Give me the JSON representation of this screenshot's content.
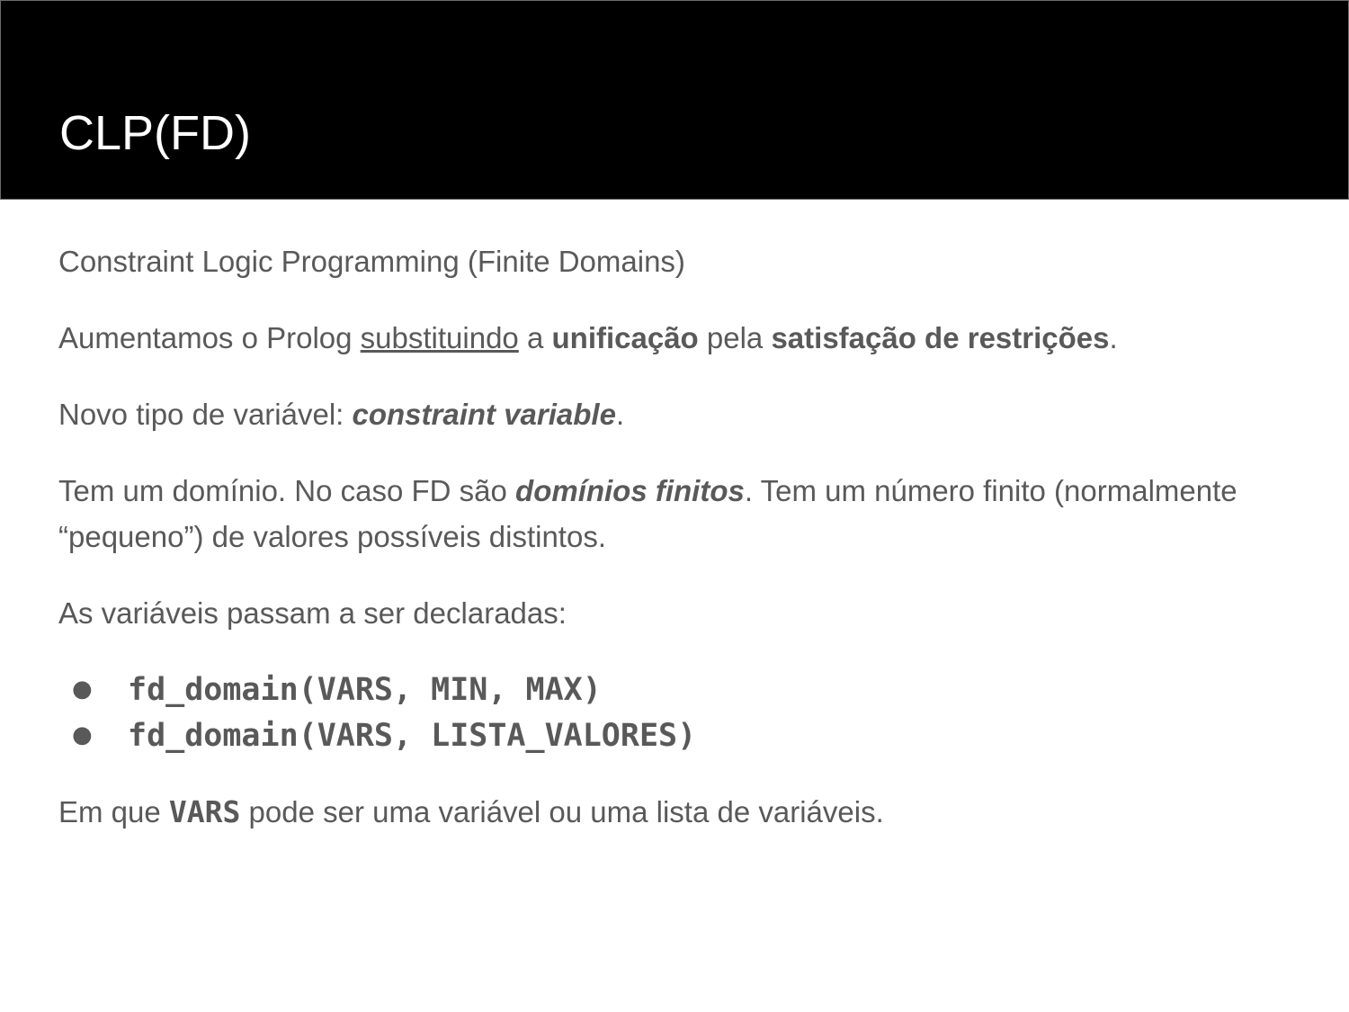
{
  "slide": {
    "title": "CLP(FD)",
    "p1": "Constraint Logic Programming (Finite Domains)",
    "p2": {
      "t1": "Aumentamos o Prolog ",
      "t2": "substituindo",
      "t3": " a ",
      "t4": "unificação",
      "t5": " pela ",
      "t6": "satisfação de restrições",
      "t7": "."
    },
    "p3": {
      "t1": "Novo tipo de variável: ",
      "t2": "constraint variable",
      "t3": "."
    },
    "p4": {
      "t1": "Tem um domínio. No caso FD são ",
      "t2": "domínios finitos",
      "t3": ". Tem um número finito (normalmente “pequeno”) de valores possíveis distintos."
    },
    "p5": "As variáveis passam a ser declaradas:",
    "code_items": [
      "fd_domain(VARS, MIN, MAX)",
      "fd_domain(VARS, LISTA_VALORES)"
    ],
    "bullet": "●",
    "p6": {
      "t1": "Em que ",
      "t2": "VARS",
      "t3": " pode ser uma variável ou uma lista de variáveis."
    }
  }
}
